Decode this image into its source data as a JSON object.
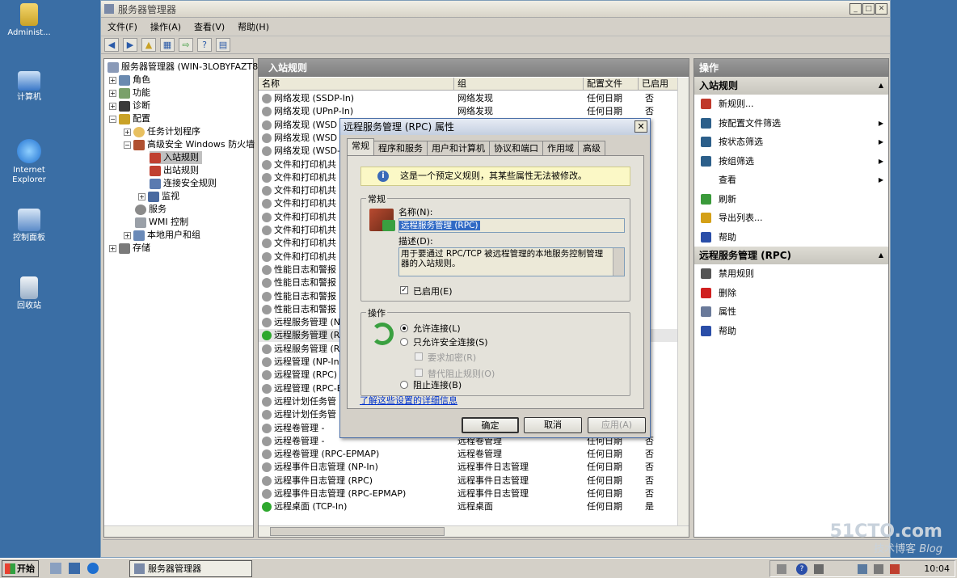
{
  "desktop": {
    "icons": [
      {
        "label": "Administ...",
        "icon": "user-folder-icon"
      },
      {
        "label": "计算机",
        "icon": "computer-icon"
      },
      {
        "label": "Internet\nExplorer",
        "icon": "ie-icon"
      },
      {
        "label": "控制面板",
        "icon": "control-panel-icon"
      },
      {
        "label": "回收站",
        "icon": "recycle-bin-icon"
      }
    ]
  },
  "window": {
    "title": "服务器管理器",
    "menu": [
      "文件(F)",
      "操作(A)",
      "查看(V)",
      "帮助(H)"
    ]
  },
  "tree": {
    "items": [
      {
        "label": "服务器管理器 (WIN-3LOBYFAZT8",
        "level": 0
      },
      {
        "label": "角色",
        "level": 1
      },
      {
        "label": "功能",
        "level": 1
      },
      {
        "label": "诊断",
        "level": 1
      },
      {
        "label": "配置",
        "level": 1
      },
      {
        "label": "任务计划程序",
        "level": 2
      },
      {
        "label": "高级安全 Windows 防火墙",
        "level": 2
      },
      {
        "label": "入站规则",
        "level": 3
      },
      {
        "label": "出站规则",
        "level": 3
      },
      {
        "label": "连接安全规则",
        "level": 3
      },
      {
        "label": "监视",
        "level": 3
      },
      {
        "label": "服务",
        "level": 2
      },
      {
        "label": "WMI 控制",
        "level": 2
      },
      {
        "label": "本地用户和组",
        "level": 2
      },
      {
        "label": "存储",
        "level": 1
      }
    ]
  },
  "center": {
    "header": "入站规则",
    "columns": [
      "名称",
      "组",
      "配置文件",
      "已启用"
    ],
    "rows": [
      {
        "name": "网络发现 (SSDP-In)",
        "group": "网络发现",
        "profile": "任何日期",
        "enabled": "否",
        "on": false
      },
      {
        "name": "网络发现 (UPnP-In)",
        "group": "网络发现",
        "profile": "任何日期",
        "enabled": "否",
        "on": false
      },
      {
        "name": "网络发现 (WSD E",
        "group": "",
        "profile": "",
        "enabled": "",
        "on": false
      },
      {
        "name": "网络发现 (WSD E",
        "group": "",
        "profile": "",
        "enabled": "",
        "on": false
      },
      {
        "name": "网络发现 (WSD-I",
        "group": "",
        "profile": "",
        "enabled": "",
        "on": false
      },
      {
        "name": "文件和打印机共",
        "group": "",
        "profile": "",
        "enabled": "",
        "on": false
      },
      {
        "name": "文件和打印机共",
        "group": "",
        "profile": "",
        "enabled": "",
        "on": false
      },
      {
        "name": "文件和打印机共",
        "group": "",
        "profile": "",
        "enabled": "",
        "on": false
      },
      {
        "name": "文件和打印机共",
        "group": "",
        "profile": "",
        "enabled": "",
        "on": false
      },
      {
        "name": "文件和打印机共",
        "group": "",
        "profile": "",
        "enabled": "",
        "on": false
      },
      {
        "name": "文件和打印机共",
        "group": "",
        "profile": "",
        "enabled": "",
        "on": false
      },
      {
        "name": "文件和打印机共",
        "group": "",
        "profile": "",
        "enabled": "",
        "on": false
      },
      {
        "name": "文件和打印机共",
        "group": "",
        "profile": "",
        "enabled": "",
        "on": false
      },
      {
        "name": "性能日志和警报",
        "group": "",
        "profile": "",
        "enabled": "",
        "on": false
      },
      {
        "name": "性能日志和警报",
        "group": "",
        "profile": "",
        "enabled": "",
        "on": false
      },
      {
        "name": "性能日志和警报",
        "group": "",
        "profile": "",
        "enabled": "",
        "on": false
      },
      {
        "name": "性能日志和警报",
        "group": "",
        "profile": "",
        "enabled": "",
        "on": false
      },
      {
        "name": "远程服务管理 (N",
        "group": "",
        "profile": "",
        "enabled": "",
        "on": false
      },
      {
        "name": "远程服务管理 (R",
        "group": "",
        "profile": "",
        "enabled": "",
        "on": true
      },
      {
        "name": "远程服务管理 (R",
        "group": "",
        "profile": "",
        "enabled": "",
        "on": false
      },
      {
        "name": "远程管理 (NP-In",
        "group": "",
        "profile": "",
        "enabled": "",
        "on": false
      },
      {
        "name": "远程管理 (RPC)",
        "group": "",
        "profile": "",
        "enabled": "",
        "on": false
      },
      {
        "name": "远程管理 (RPC-E",
        "group": "",
        "profile": "",
        "enabled": "",
        "on": false
      },
      {
        "name": "远程计划任务管",
        "group": "",
        "profile": "",
        "enabled": "",
        "on": false
      },
      {
        "name": "远程计划任务管",
        "group": "",
        "profile": "",
        "enabled": "",
        "on": false
      },
      {
        "name": "远程卷管理 -",
        "group": "",
        "profile": "",
        "enabled": "",
        "on": false
      },
      {
        "name": "远程卷管理 -",
        "group": "远程卷管理",
        "profile": "任何日期",
        "enabled": "否",
        "on": false
      },
      {
        "name": "远程卷管理 (RPC-EPMAP)",
        "group": "远程卷管理",
        "profile": "任何日期",
        "enabled": "否",
        "on": false
      },
      {
        "name": "远程事件日志管理 (NP-In)",
        "group": "远程事件日志管理",
        "profile": "任何日期",
        "enabled": "否",
        "on": false
      },
      {
        "name": "远程事件日志管理 (RPC)",
        "group": "远程事件日志管理",
        "profile": "任何日期",
        "enabled": "否",
        "on": false
      },
      {
        "name": "远程事件日志管理 (RPC-EPMAP)",
        "group": "远程事件日志管理",
        "profile": "任何日期",
        "enabled": "否",
        "on": false
      },
      {
        "name": "远程桌面 (TCP-In)",
        "group": "远程桌面",
        "profile": "任何日期",
        "enabled": "是",
        "on": true
      }
    ]
  },
  "actions": {
    "header": "操作",
    "section1": {
      "title": "入站规则",
      "items": [
        {
          "label": "新规则...",
          "icon": "new-rule-icon",
          "color": "#c0392b",
          "arrow": false
        },
        {
          "label": "按配置文件筛选",
          "icon": "filter-icon",
          "color": "#2c5f8a",
          "arrow": true
        },
        {
          "label": "按状态筛选",
          "icon": "filter-icon",
          "color": "#2c5f8a",
          "arrow": true
        },
        {
          "label": "按组筛选",
          "icon": "filter-icon",
          "color": "#2c5f8a",
          "arrow": true
        },
        {
          "label": "查看",
          "icon": "",
          "color": "",
          "arrow": true
        },
        {
          "label": "刷新",
          "icon": "refresh-icon",
          "color": "#3a9a3a",
          "arrow": false
        },
        {
          "label": "导出列表...",
          "icon": "export-icon",
          "color": "#d4a017",
          "arrow": false
        },
        {
          "label": "帮助",
          "icon": "help-icon",
          "color": "#2a4ea8",
          "arrow": false
        }
      ]
    },
    "section2": {
      "title": "远程服务管理 (RPC)",
      "items": [
        {
          "label": "禁用规则",
          "icon": "disable-icon",
          "color": "#555555"
        },
        {
          "label": "删除",
          "icon": "delete-icon",
          "color": "#d02020"
        },
        {
          "label": "属性",
          "icon": "properties-icon",
          "color": "#6a7a9a"
        },
        {
          "label": "帮助",
          "icon": "help-icon",
          "color": "#2a4ea8"
        }
      ]
    }
  },
  "dialog": {
    "title": "远程服务管理 (RPC) 属性",
    "tabs": [
      "常规",
      "程序和服务",
      "用户和计算机",
      "协议和端口",
      "作用域",
      "高级"
    ],
    "info": "这是一个预定义规则，其某些属性无法被修改。",
    "general_group": "常规",
    "name_label": "名称(N):",
    "name_value": "远程服务管理 (RPC)",
    "desc_label": "描述(D):",
    "desc_value": "用于要通过 RPC/TCP 被远程管理的本地服务控制管理器的入站规则。",
    "enabled_label": "已启用(E)",
    "action_group": "操作",
    "allow_label": "允许连接(L)",
    "secure_label": "只允许安全连接(S)",
    "encrypt_label": "要求加密(R)",
    "override_label": "替代阻止规则(O)",
    "block_label": "阻止连接(B)",
    "link": "了解这些设置的详细信息",
    "ok": "确定",
    "cancel": "取消",
    "apply": "应用(A)"
  },
  "taskbar": {
    "start": "开始",
    "task": "服务器管理器",
    "clock": "10:04"
  },
  "watermark": {
    "line1": "51CTO.com",
    "line2": "技术博客",
    "line3": "Blog"
  }
}
